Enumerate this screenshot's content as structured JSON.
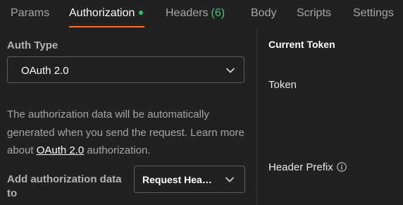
{
  "tabs": [
    {
      "label": "Params"
    },
    {
      "label": "Authorization",
      "indicator": "green-dot"
    },
    {
      "label": "Headers",
      "count": "(6)"
    },
    {
      "label": "Body"
    },
    {
      "label": "Scripts"
    },
    {
      "label": "Settings"
    }
  ],
  "active_tab": "Authorization",
  "colors": {
    "background": "#212121",
    "active_underline": "#ff6c37",
    "indicator_dot": "#2ebd6b",
    "count": "#4ec279"
  },
  "auth": {
    "type_label": "Auth Type",
    "type_value": "OAuth 2.0",
    "description_before": "The authorization data will be automatically generated when you send the request. Learn more about ",
    "description_link": "OAuth 2.0",
    "description_after": " authorization.",
    "add_to_label": "Add authorization data to",
    "add_to_value": "Request Headers"
  },
  "right_panel": {
    "title": "Current Token",
    "token_label": "Token",
    "header_prefix_label": "Header Prefix"
  },
  "icons": {
    "chevron": "chevron-down-icon",
    "info": "info-icon"
  }
}
